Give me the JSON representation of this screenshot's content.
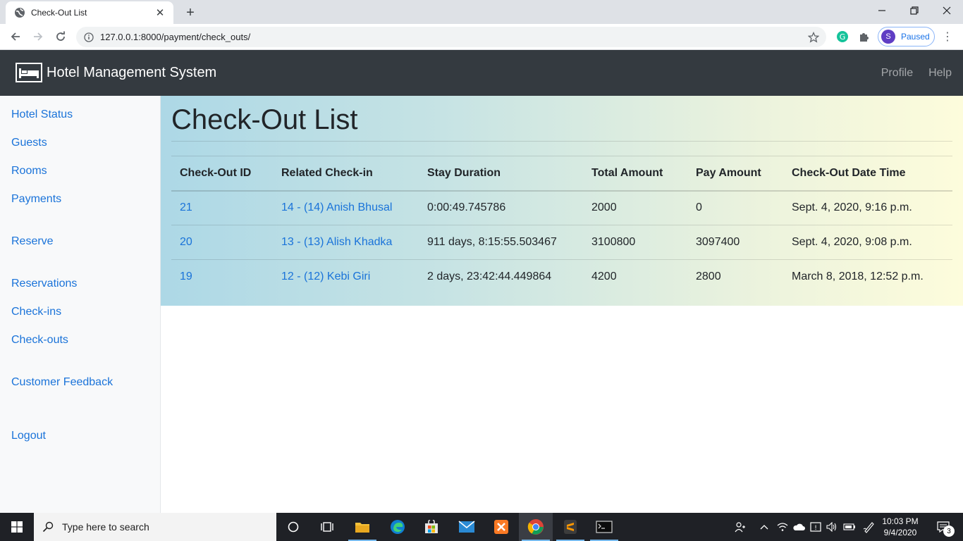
{
  "browser": {
    "tab_title": "Check-Out List",
    "url": "127.0.0.1:8000/payment/check_outs/",
    "profile_initial": "S",
    "profile_status": "Paused"
  },
  "app": {
    "brand": "Hotel Management System",
    "nav": {
      "profile": "Profile",
      "help": "Help"
    }
  },
  "sidebar": {
    "items": [
      {
        "label": "Hotel Status"
      },
      {
        "label": "Guests"
      },
      {
        "label": "Rooms"
      },
      {
        "label": "Payments"
      },
      {
        "label": "Reserve"
      },
      {
        "label": "Reservations"
      },
      {
        "label": "Check-ins"
      },
      {
        "label": "Check-outs"
      },
      {
        "label": "Customer Feedback"
      },
      {
        "label": "Logout"
      }
    ]
  },
  "main": {
    "title": "Check-Out List",
    "columns": [
      "Check-Out ID",
      "Related Check-in",
      "Stay Duration",
      "Total Amount",
      "Pay Amount",
      "Check-Out Date Time"
    ],
    "rows": [
      {
        "id": "21",
        "checkin": "14 - (14) Anish Bhusal",
        "duration": "0:00:49.745786",
        "total": "2000",
        "pay": "0",
        "datetime": "Sept. 4, 2020, 9:16 p.m."
      },
      {
        "id": "20",
        "checkin": "13 - (13) Alish Khadka",
        "duration": "911 days, 8:15:55.503467",
        "total": "3100800",
        "pay": "3097400",
        "datetime": "Sept. 4, 2020, 9:08 p.m."
      },
      {
        "id": "19",
        "checkin": "12 - (12) Kebi Giri",
        "duration": "2 days, 23:42:44.449864",
        "total": "4200",
        "pay": "2800",
        "datetime": "March 8, 2018, 12:52 p.m."
      }
    ]
  },
  "taskbar": {
    "search_placeholder": "Type here to search",
    "time": "10:03 PM",
    "date": "9/4/2020",
    "notification_count": "3"
  },
  "colors": {
    "navbar": "#343a40",
    "link": "#1a73d9",
    "gradient_start": "#add8e6",
    "gradient_end": "#fdfcdc"
  }
}
